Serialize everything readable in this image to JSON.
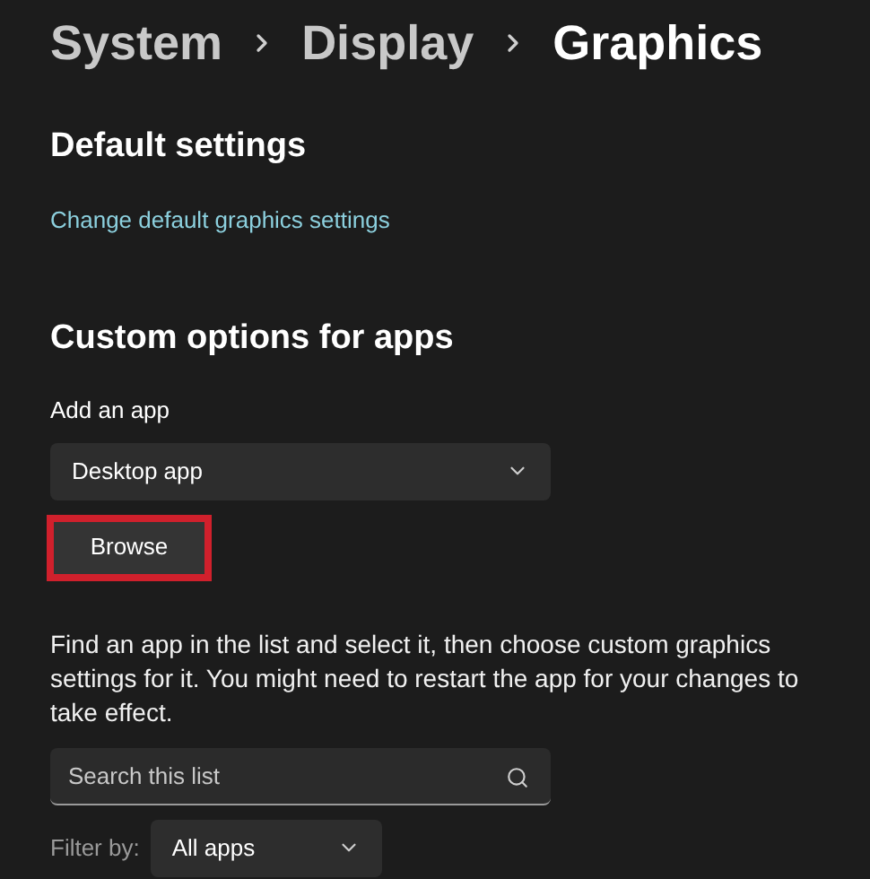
{
  "breadcrumb": [
    {
      "label": "System",
      "current": false
    },
    {
      "label": "Display",
      "current": false
    },
    {
      "label": "Graphics",
      "current": true
    }
  ],
  "default_settings": {
    "heading": "Default settings",
    "link": "Change default graphics settings"
  },
  "custom_options": {
    "heading": "Custom options for apps",
    "add_label": "Add an app",
    "app_type": "Desktop app",
    "browse_button": {
      "label": "Browse",
      "highlighted": true
    },
    "description": "Find an app in the list and select it, then choose custom graphics settings for it. You might need to restart the app for your changes to take effect.",
    "search": {
      "placeholder": "Search this list"
    },
    "filter": {
      "label": "Filter by:",
      "value": "All apps"
    }
  }
}
